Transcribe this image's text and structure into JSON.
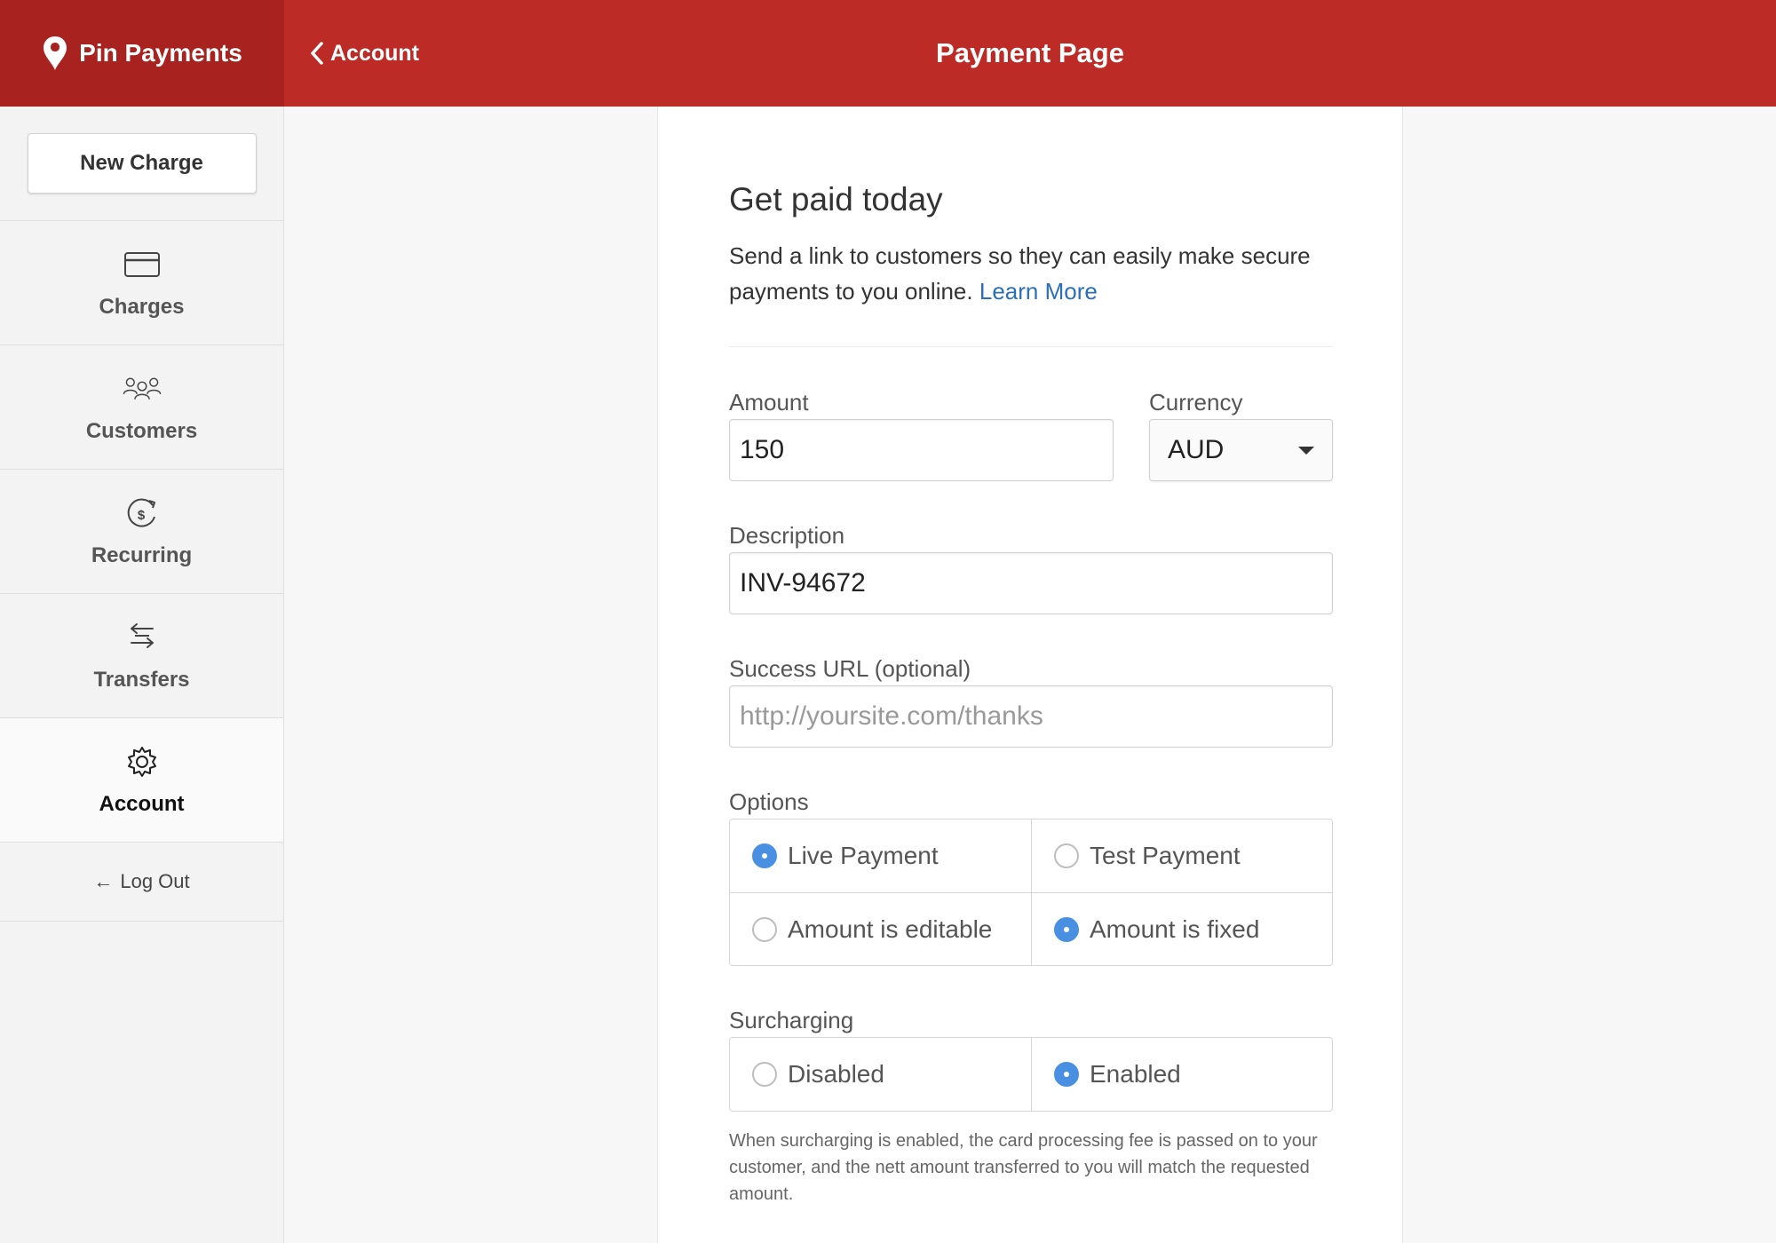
{
  "brand": {
    "name": "Pin Payments",
    "color": "#bc2b25"
  },
  "header": {
    "back_label": "Account",
    "title": "Payment Page"
  },
  "sidebar": {
    "new_charge": "New Charge",
    "items": [
      {
        "label": "Charges",
        "icon": "credit-card-icon"
      },
      {
        "label": "Customers",
        "icon": "users-icon"
      },
      {
        "label": "Recurring",
        "icon": "recurring-dollar-icon"
      },
      {
        "label": "Transfers",
        "icon": "transfer-arrows-icon"
      },
      {
        "label": "Account",
        "icon": "gear-icon",
        "active": true
      }
    ],
    "logout": "Log Out"
  },
  "main": {
    "heading": "Get paid today",
    "intro": "Send a link to customers so they can easily make secure payments to you online.",
    "learn_more": "Learn More",
    "amount_label": "Amount",
    "amount_value": "150",
    "currency_label": "Currency",
    "currency_value": "AUD",
    "description_label": "Description",
    "description_value": "INV-94672",
    "success_url_label": "Success URL (optional)",
    "success_url_placeholder": "http://yoursite.com/thanks",
    "options_label": "Options",
    "options": {
      "live": "Live Payment",
      "test": "Test Payment",
      "editable": "Amount is editable",
      "fixed": "Amount is fixed"
    },
    "surcharging_label": "Surcharging",
    "surcharging": {
      "disabled": "Disabled",
      "enabled": "Enabled"
    },
    "surcharge_help": "When surcharging is enabled, the card processing fee is passed on to your customer, and the nett amount transferred to you will match the requested amount."
  }
}
